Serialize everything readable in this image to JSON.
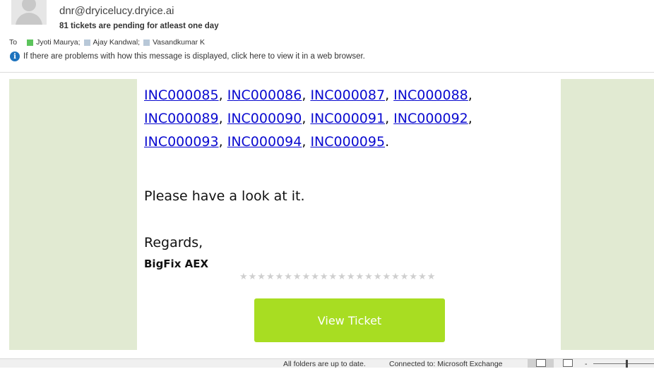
{
  "header": {
    "sender": "dnr@dryicelucy.dryice.ai",
    "subject": "81 tickets are pending for atleast one day",
    "to_label": "To",
    "recipients": [
      {
        "name": "Jyoti Maurya;",
        "presence_color": "#5cc45c"
      },
      {
        "name": "Ajay Kandwal;",
        "presence_color": "#b8c8d8"
      },
      {
        "name": "Vasandkumar K",
        "presence_color": "#b8c8d8"
      }
    ],
    "info_icon": "i",
    "info_text": "If there are problems with how this message is displayed, click here to view it in a web browser."
  },
  "body": {
    "tickets": [
      "INC000085",
      "INC000086",
      "INC000087",
      "INC000088",
      "INC000089",
      "INC000090",
      "INC000091",
      "INC000092",
      "INC000093",
      "INC000094",
      "INC000095"
    ],
    "separator": ", ",
    "terminator": ".",
    "look_text": "Please have a look at it.",
    "regards": "Regards,",
    "signature": "BigFix AEX",
    "stars": "★★★★★★★★★★★★★★★★★★★★★★",
    "view_ticket_label": "View Ticket",
    "accent_color": "#a8dd22",
    "side_color": "#e1ead2"
  },
  "statusbar": {
    "folders_status": "All folders are up to date.",
    "connection_status": "Connected to: Microsoft Exchange",
    "zoom_minus": "-"
  }
}
